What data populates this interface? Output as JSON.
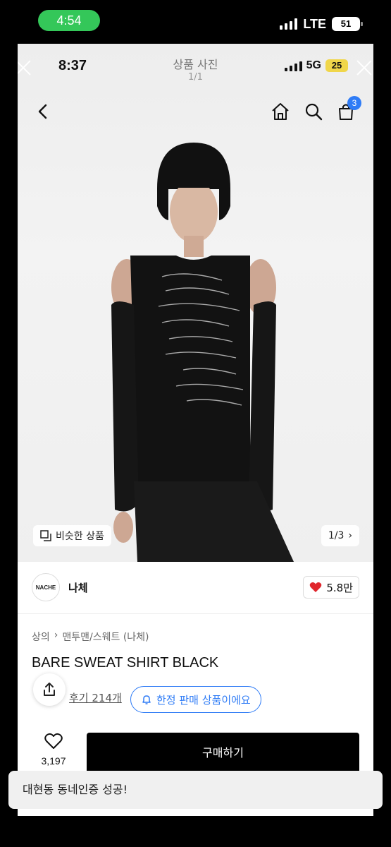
{
  "outer_status": {
    "time": "4:54",
    "network": "LTE",
    "battery": "51"
  },
  "inner_status": {
    "time": "8:37",
    "network": "5G",
    "battery": "25"
  },
  "viewer": {
    "title": "상품 사진",
    "count": "1/1"
  },
  "nav": {
    "cart_count": "3"
  },
  "image_overlay": {
    "similar_label": "비슷한 상품",
    "pager": "1/3"
  },
  "brand": {
    "logo_text": "NACHE",
    "name": "나체",
    "likes": "5.8만"
  },
  "breadcrumb": [
    "상의",
    "맨투맨/스웨트 (나체)"
  ],
  "product": {
    "title": "BARE SWEAT SHIRT BLACK",
    "reviews": "후기 214개",
    "limited_label": "한정 판매 상품이에요"
  },
  "bottom": {
    "wish_count": "3,197",
    "buy_label": "구매하기"
  },
  "toast": "대현동 동네인증 성공!",
  "colors": {
    "accent": "#2f7cf6",
    "heart": "#e0262c",
    "status_green": "#34c759"
  }
}
